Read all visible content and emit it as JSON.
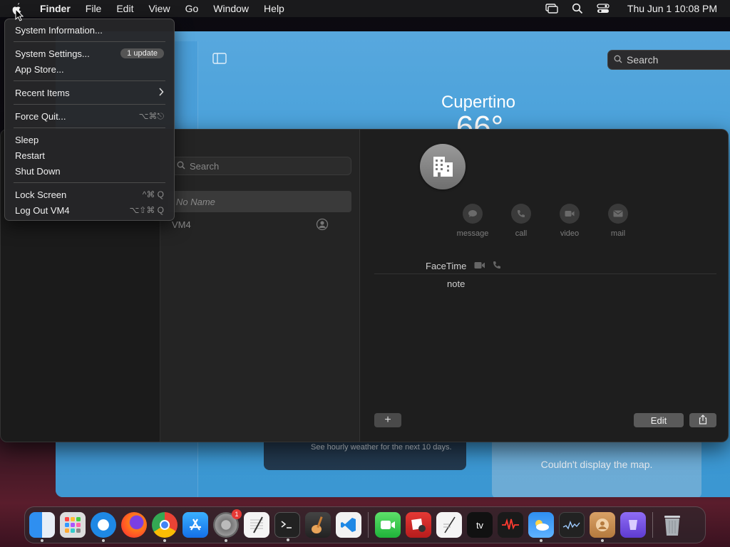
{
  "menubar": {
    "app_name": "Finder",
    "items": [
      "File",
      "Edit",
      "View",
      "Go",
      "Window",
      "Help"
    ],
    "clock": "Thu Jun 1  10:08 PM"
  },
  "apple_menu": {
    "system_information": "System Information...",
    "system_settings": "System Settings...",
    "system_settings_badge": "1 update",
    "app_store": "App Store...",
    "recent_items": "Recent Items",
    "force_quit": "Force Quit...",
    "force_quit_shortcut": "⌥⌘⎋",
    "sleep": "Sleep",
    "restart": "Restart",
    "shut_down": "Shut Down",
    "lock_screen": "Lock Screen",
    "lock_screen_shortcut": "^⌘ Q",
    "log_out": "Log Out VM4",
    "log_out_shortcut": "⌥⇧⌘ Q"
  },
  "weather": {
    "search_placeholder": "Search",
    "city": "Cupertino",
    "temperature": "66°",
    "hourly_hint": "See hourly weather for the next 10 days.",
    "map_error": "Couldn't display the map."
  },
  "contacts": {
    "search_placeholder": "Search",
    "no_name": "No Name",
    "me_card": "VM4",
    "actions": [
      "message",
      "call",
      "video",
      "mail"
    ],
    "facetime_label": "FaceTime",
    "note_label": "note",
    "add_label": "+",
    "edit_label": "Edit"
  },
  "dock": {
    "apps": [
      "finder",
      "launchpad",
      "safari",
      "firefox",
      "chrome",
      "app-store",
      "system-settings",
      "textedit",
      "terminal",
      "garageband",
      "vscode",
      "facetime",
      "photo-booth",
      "script-editor",
      "apple-tv",
      "voice-memos",
      "weather",
      "activity-monitor",
      "contacts",
      "podcasts-purple"
    ],
    "system_settings_badge": "1"
  }
}
